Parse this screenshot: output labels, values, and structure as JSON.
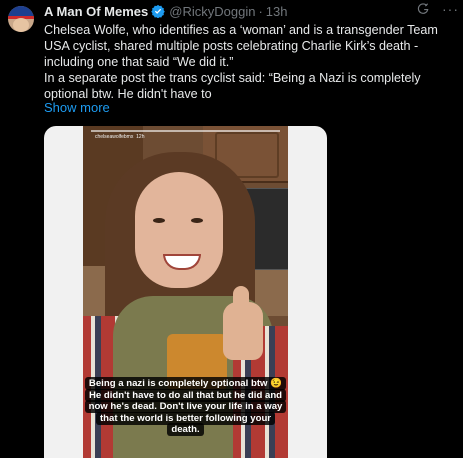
{
  "post": {
    "display_name": "A Man Of Memes",
    "handle": "@RickyDoggin",
    "separator": "·",
    "time": "13h",
    "more_label": "···",
    "text_line1": "Chelsea Wolfe, who identifies as a ‘woman’ and is a transgender Team USA cyclist, shared multiple posts celebrating Charlie Kirk’s death -  including one that said “We did it.”",
    "text_line2": "In a separate post the trans cyclist said: “Being a Nazi is completely optional btw. He didn't have to",
    "show_more": "Show more"
  },
  "media": {
    "story_username": "chelseawolfebmx",
    "story_time": "12h",
    "caption": "Being a nazi is completely optional btw 😉 He didn't have to do all that but he did and now he's dead. Don't live your life in a way that the world is better following your death."
  },
  "colors": {
    "background": "#000000",
    "text": "#e7e9ea",
    "muted": "#71767b",
    "link": "#1d9bf0",
    "verified": "#1d9bf0"
  },
  "icons": [
    "verified-badge-icon",
    "grok-icon",
    "more-options-icon"
  ]
}
